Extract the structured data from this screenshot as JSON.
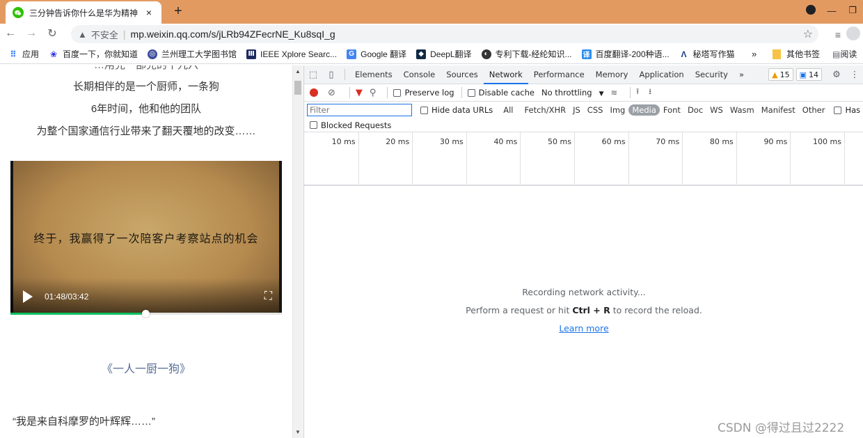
{
  "tab": {
    "title": "三分钟告诉你什么是华为精神",
    "close": "×",
    "new": "+"
  },
  "window": {
    "minimize": "—",
    "restore": "❐"
  },
  "omnibox": {
    "security": "不安全",
    "url": "mp.weixin.qq.com/s/jLRb94ZFecrNE_Ku8sqI_g"
  },
  "bookmarks": {
    "items": [
      {
        "label": "应用",
        "icon": "apps-grid-icon",
        "color": "#4285f4"
      },
      {
        "label": "百度一下，你就知道",
        "icon": "baidu-paw-icon",
        "color": "#2932e1"
      },
      {
        "label": "兰州理工大学图书馆",
        "icon": "library-icon",
        "color": "#3c4d9c"
      },
      {
        "label": "IEEE Xplore Searc...",
        "icon": "ieee-icon",
        "color": "#1c2a5e"
      },
      {
        "label": "Google 翻译",
        "icon": "google-translate-icon",
        "color": "#4285f4"
      },
      {
        "label": "DeepL翻译",
        "icon": "deepl-icon",
        "color": "#0f2b46"
      },
      {
        "label": "专利下载-经纶知识...",
        "icon": "globe-icon",
        "color": "#333333"
      },
      {
        "label": "百度翻译-200种语...",
        "icon": "baidu-translate-icon",
        "color": "#2b8cf3"
      },
      {
        "label": "秘塔写作猫",
        "icon": "metaso-icon",
        "color": "#1b3a8a"
      }
    ],
    "more": "»",
    "folder": "其他书签",
    "reading": "阅读"
  },
  "article": {
    "lines": [
      "长期相伴的是一个厨师，一条狗",
      "6年时间，他和他的团队",
      "为整个国家通信行业带来了翻天覆地的改变……"
    ],
    "clipped_line": "…用完一部完的十九六",
    "video": {
      "subtitle": "终于，我赢得了一次陪客户考察站点的机会",
      "time": "01:48/03:42",
      "progress": 0.497
    },
    "title": "《一人一厨一狗》",
    "quote": "“我是来自科摩罗的叶辉辉……”"
  },
  "devtools": {
    "tabs": [
      "Elements",
      "Console",
      "Sources",
      "Network",
      "Performance",
      "Memory",
      "Application",
      "Security"
    ],
    "active_tab": "Network",
    "more_tabs": "»",
    "warnings": "15",
    "messages": "14",
    "toolbar": {
      "preserve_log": "Preserve log",
      "disable_cache": "Disable cache",
      "throttling": "No throttling"
    },
    "filter": {
      "placeholder": "Filter",
      "hide_data_urls": "Hide data URLs",
      "types": [
        "All",
        "Fetch/XHR",
        "JS",
        "CSS",
        "Img",
        "Media",
        "Font",
        "Doc",
        "WS",
        "Wasm",
        "Manifest",
        "Other"
      ],
      "active_type": "Media",
      "has_blocked_cookies": "Has blocked cookies",
      "blocked_requests": "Blocked Requests"
    },
    "timeline_ticks": [
      "10 ms",
      "20 ms",
      "30 ms",
      "40 ms",
      "50 ms",
      "60 ms",
      "70 ms",
      "80 ms",
      "90 ms",
      "100 ms"
    ],
    "empty": {
      "line1": "Recording network activity...",
      "line2_pre": "Perform a request or hit ",
      "shortcut": "Ctrl + R",
      "line2_post": " to record the reload.",
      "link": "Learn more"
    }
  },
  "watermark": "CSDN @得过且过2222"
}
